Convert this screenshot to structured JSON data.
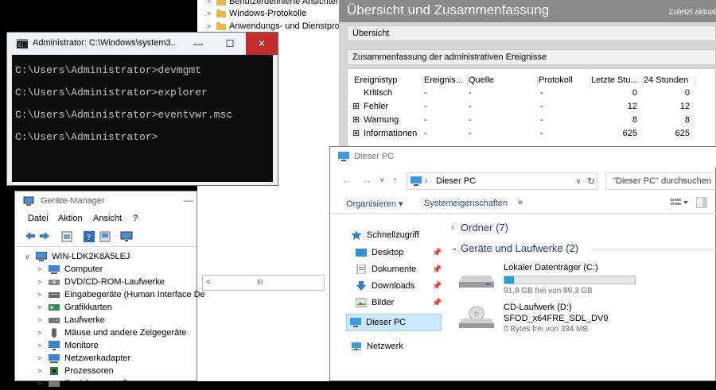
{
  "event_viewer": {
    "tree_items": [
      "Benutzerdefinierte Ansichten",
      "Windows-Protokolle",
      "Anwendungs- und Dienstpro"
    ],
    "title": "Übersicht und Zusammenfassung",
    "last_updated": "Zuletzt aktual",
    "section_overview": "Übersicht",
    "section_summary": "Zusammenfassung der administrativen Ereignisse",
    "columns": [
      "Ereignistyp",
      "Ereignis...",
      "Quelle",
      "Protokoll",
      "Letzte Stu...",
      "24 Stunden"
    ],
    "rows": [
      {
        "type": "Kritisch",
        "id": "-",
        "source": "-",
        "log": "-",
        "last_hour": "0",
        "day": "0",
        "expandable": false
      },
      {
        "type": "Fehler",
        "id": "-",
        "source": "-",
        "log": "-",
        "last_hour": "12",
        "day": "12",
        "expandable": true
      },
      {
        "type": "Warnung",
        "id": "-",
        "source": "-",
        "log": "-",
        "last_hour": "8",
        "day": "8",
        "expandable": true
      },
      {
        "type": "Informationen",
        "id": "-",
        "source": "-",
        "log": "-",
        "last_hour": "625",
        "day": "625",
        "expandable": true
      }
    ],
    "scroll_label": "III"
  },
  "cmd": {
    "title": "Administrator: C:\\Windows\\system3...",
    "lines": [
      "C:\\Users\\Administrator>devmgmt",
      "C:\\Users\\Administrator>explorer",
      "C:\\Users\\Administrator>eventvwr.msc",
      "C:\\Users\\Administrator>"
    ],
    "buttons": {
      "minimize": "—",
      "maximize": "☐",
      "close": "✕"
    }
  },
  "device_manager": {
    "title": "Geräte-Manager",
    "menu": [
      "Datei",
      "Aktion",
      "Ansicht",
      "?"
    ],
    "root": "WIN-LDK2K8A5LEJ",
    "items": [
      "Computer",
      "DVD/CD-ROM-Laufwerke",
      "Eingabegeräte (Human Interface De",
      "Grafikkarten",
      "Laufwerke",
      "Mäuse und andere Zeigegeräte",
      "Monitore",
      "Netzwerkadapter",
      "Prozessoren",
      "Speichercontroller"
    ]
  },
  "explorer": {
    "title": "Dieser PC",
    "address": "Dieser PC",
    "search_placeholder": "\"Dieser PC\" durchsuchen",
    "commands": [
      "Organisieren",
      "Systemeigenschaften",
      "»"
    ],
    "nav": {
      "quick_access": "Schnellzugriff",
      "quick_items": [
        "Desktop",
        "Dokumente",
        "Downloads",
        "Bilder"
      ],
      "this_pc": "Dieser PC",
      "network": "Netzwerk"
    },
    "groups": {
      "folders": "Ordner (7)",
      "drives": "Geräte und Laufwerke (2)"
    },
    "drives": [
      {
        "name": "Lokaler Datenträger (C:)",
        "space": "91,8 GB frei von 99,3 GB",
        "used_fraction": 0.076
      },
      {
        "name": "CD-Laufwerk (D:)",
        "label": "SFOD_x64FRE_SDL_DV9",
        "space": "0 Bytes frei von 334 MB"
      }
    ]
  },
  "colors": {
    "title_gray": "#8a8a8a",
    "accent_blue": "#1e73c7",
    "drive_bar": "#26a0da",
    "cmd_bg": "#0c0c0c",
    "close_red": "#e81123"
  }
}
